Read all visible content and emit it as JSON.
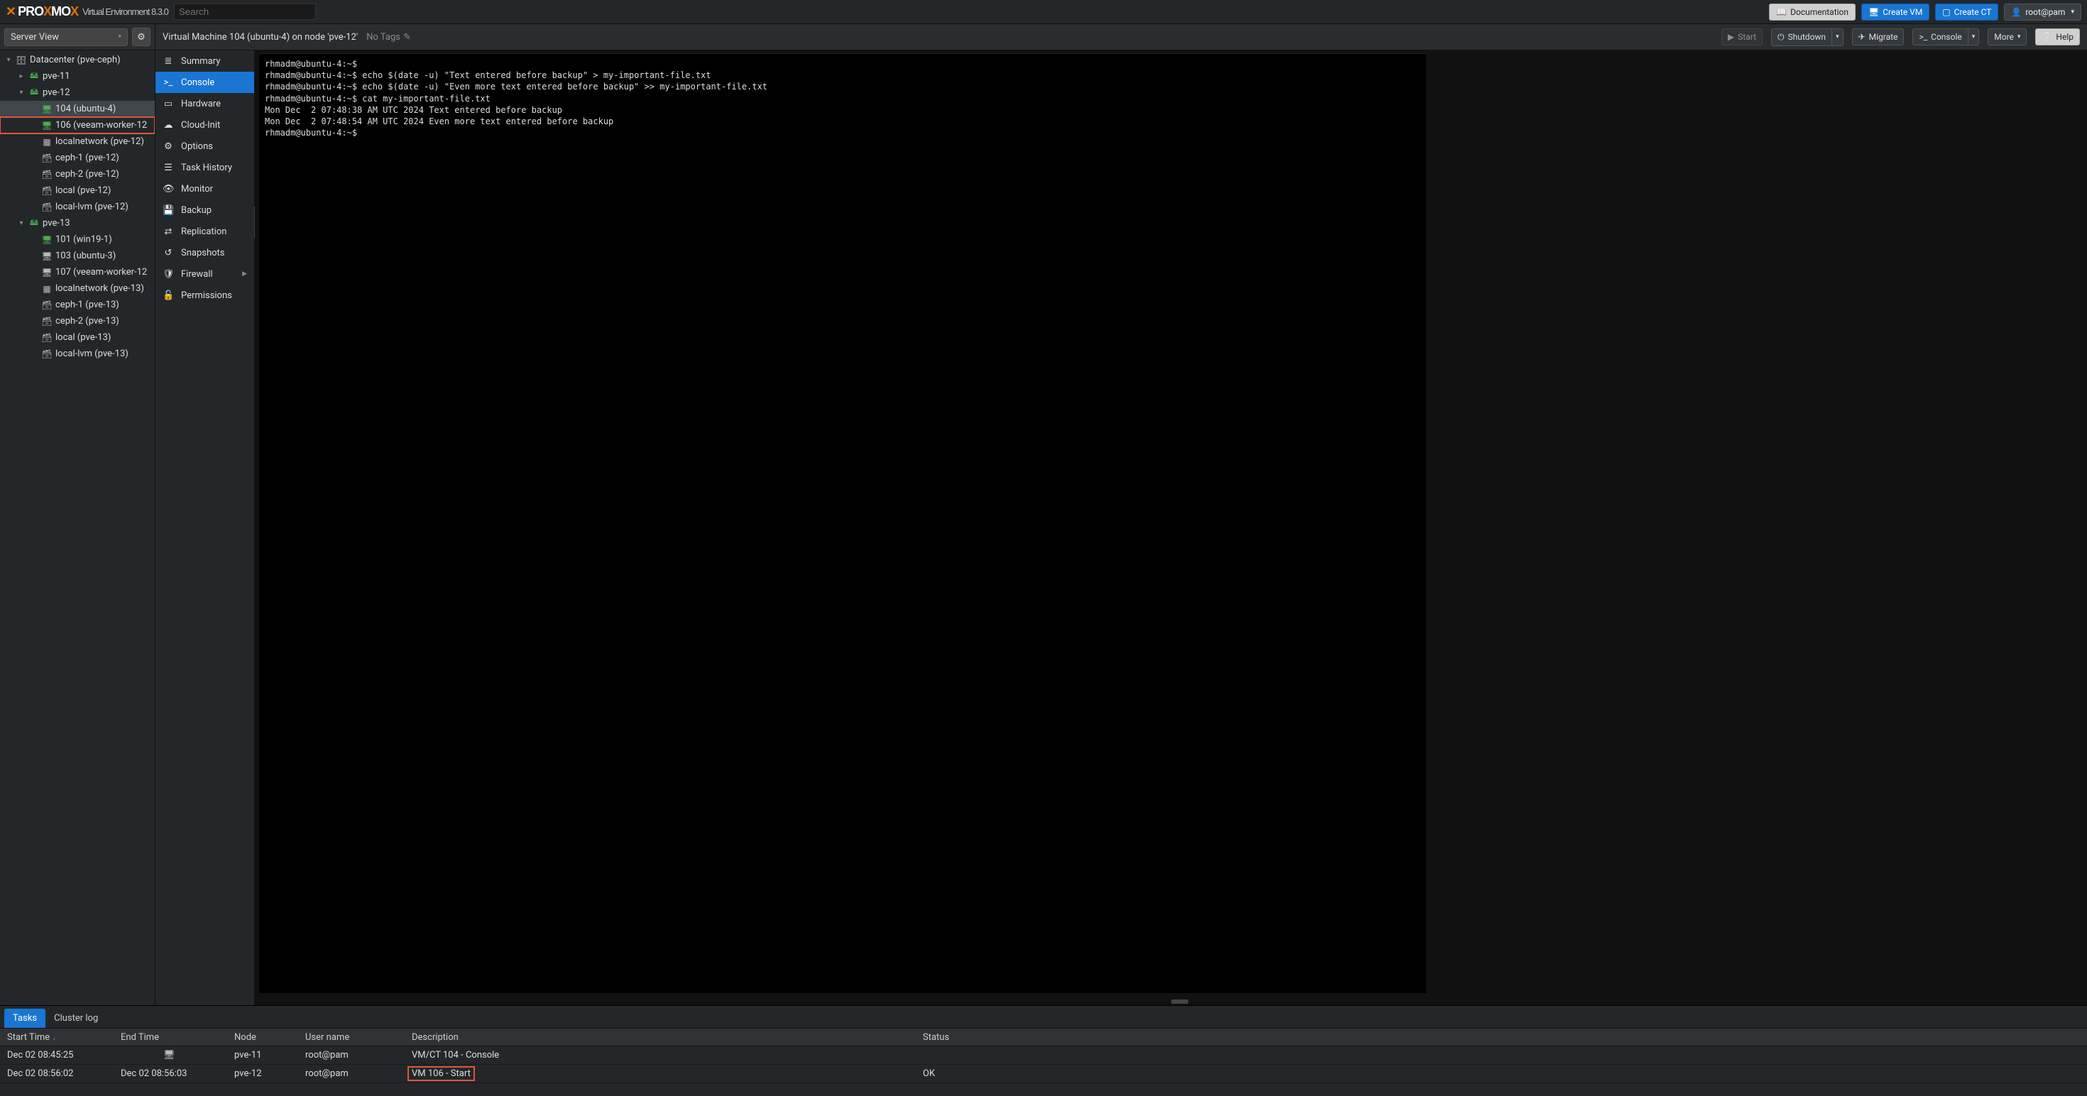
{
  "header": {
    "product": "PROXMOX",
    "env_label": "Virtual Environment 8.3.0",
    "search_placeholder": "Search",
    "buttons": {
      "documentation": "Documentation",
      "create_vm": "Create VM",
      "create_ct": "Create CT",
      "user": "root@pam"
    }
  },
  "view_selector": {
    "label": "Server View"
  },
  "content_header": {
    "title": "Virtual Machine 104 (ubuntu-4) on node 'pve-12'",
    "no_tags": "No Tags",
    "actions": {
      "start": "Start",
      "shutdown": "Shutdown",
      "migrate": "Migrate",
      "console": "Console",
      "more": "More",
      "help": "Help"
    }
  },
  "tree": [
    {
      "depth": 0,
      "exp": "▾",
      "icon": "dc",
      "label": "Datacenter (pve-ceph)"
    },
    {
      "depth": 1,
      "exp": "▸",
      "icon": "node",
      "label": "pve-11",
      "running": true
    },
    {
      "depth": 1,
      "exp": "▾",
      "icon": "node",
      "label": "pve-12",
      "running": true
    },
    {
      "depth": 2,
      "exp": "",
      "icon": "vm",
      "label": "104 (ubuntu-4)",
      "running": true,
      "selected": true
    },
    {
      "depth": 2,
      "exp": "",
      "icon": "vm",
      "label": "106 (veeam-worker-12",
      "running": true,
      "highlight": true
    },
    {
      "depth": 2,
      "exp": "",
      "icon": "net",
      "label": "localnetwork (pve-12)"
    },
    {
      "depth": 2,
      "exp": "",
      "icon": "stor",
      "label": "ceph-1 (pve-12)"
    },
    {
      "depth": 2,
      "exp": "",
      "icon": "stor",
      "label": "ceph-2 (pve-12)"
    },
    {
      "depth": 2,
      "exp": "",
      "icon": "stor",
      "label": "local (pve-12)"
    },
    {
      "depth": 2,
      "exp": "",
      "icon": "stor",
      "label": "local-lvm (pve-12)"
    },
    {
      "depth": 1,
      "exp": "▾",
      "icon": "node",
      "label": "pve-13",
      "running": true
    },
    {
      "depth": 2,
      "exp": "",
      "icon": "vm",
      "label": "101 (win19-1)",
      "running": true
    },
    {
      "depth": 2,
      "exp": "",
      "icon": "vm",
      "label": "103 (ubuntu-3)"
    },
    {
      "depth": 2,
      "exp": "",
      "icon": "vm",
      "label": "107 (veeam-worker-12"
    },
    {
      "depth": 2,
      "exp": "",
      "icon": "net",
      "label": "localnetwork (pve-13)"
    },
    {
      "depth": 2,
      "exp": "",
      "icon": "stor",
      "label": "ceph-1 (pve-13)"
    },
    {
      "depth": 2,
      "exp": "",
      "icon": "stor",
      "label": "ceph-2 (pve-13)"
    },
    {
      "depth": 2,
      "exp": "",
      "icon": "stor",
      "label": "local (pve-13)"
    },
    {
      "depth": 2,
      "exp": "",
      "icon": "stor",
      "label": "local-lvm (pve-13)"
    }
  ],
  "menu": [
    {
      "icon": "≣",
      "label": "Summary"
    },
    {
      "icon": ">_",
      "label": "Console",
      "active": true
    },
    {
      "icon": "▭",
      "label": "Hardware"
    },
    {
      "icon": "☁",
      "label": "Cloud-Init"
    },
    {
      "icon": "⚙",
      "label": "Options"
    },
    {
      "icon": "☰",
      "label": "Task History"
    },
    {
      "icon": "👁",
      "label": "Monitor"
    },
    {
      "icon": "💾",
      "label": "Backup"
    },
    {
      "icon": "⇄",
      "label": "Replication"
    },
    {
      "icon": "↺",
      "label": "Snapshots"
    },
    {
      "icon": "🛡",
      "label": "Firewall",
      "sub": true
    },
    {
      "icon": "🔓",
      "label": "Permissions"
    }
  ],
  "console_lines": [
    "rhmadm@ubuntu-4:~$",
    "rhmadm@ubuntu-4:~$ echo $(date -u) \"Text entered before backup\" > my-important-file.txt",
    "rhmadm@ubuntu-4:~$ echo $(date -u) \"Even more text entered before backup\" >> my-important-file.txt",
    "rhmadm@ubuntu-4:~$ cat my-important-file.txt",
    "Mon Dec  2 07:48:38 AM UTC 2024 Text entered before backup",
    "Mon Dec  2 07:48:54 AM UTC 2024 Even more text entered before backup",
    "rhmadm@ubuntu-4:~$"
  ],
  "tasklog": {
    "tabs": {
      "tasks": "Tasks",
      "cluster": "Cluster log"
    },
    "columns": {
      "start": "Start Time",
      "end": "End Time",
      "node": "Node",
      "user": "User name",
      "desc": "Description",
      "status": "Status"
    },
    "rows": [
      {
        "start": "Dec 02 08:45:25",
        "end_icon": true,
        "end": "",
        "node": "pve-11",
        "user": "root@pam",
        "desc": "VM/CT 104 - Console",
        "status": ""
      },
      {
        "start": "Dec 02 08:56:02",
        "end": "Dec 02 08:56:03",
        "node": "pve-12",
        "user": "root@pam",
        "desc": "VM 106 - Start",
        "status": "OK",
        "mark": true
      }
    ]
  }
}
